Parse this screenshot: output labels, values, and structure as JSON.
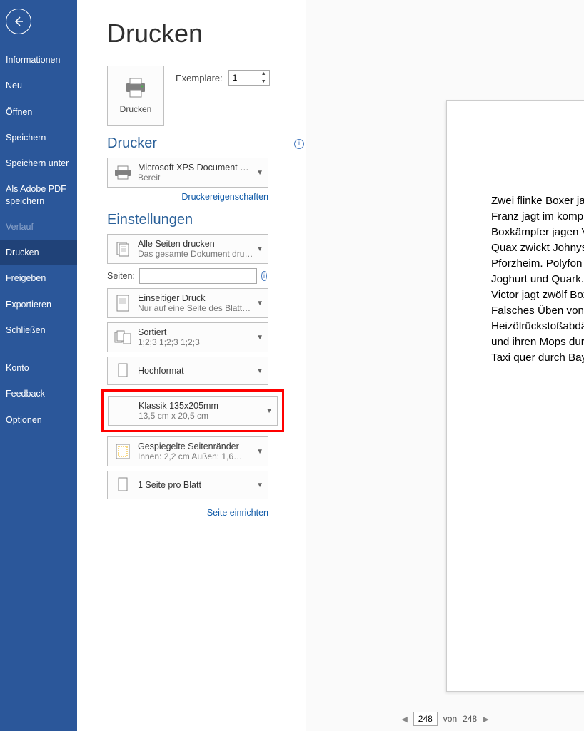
{
  "sidebar": {
    "items": [
      {
        "label": "Informationen"
      },
      {
        "label": "Neu"
      },
      {
        "label": "Öffnen"
      },
      {
        "label": "Speichern"
      },
      {
        "label": "Speichern unter"
      },
      {
        "label": "Als Adobe PDF speichern"
      },
      {
        "label": "Verlauf"
      },
      {
        "label": "Drucken"
      },
      {
        "label": "Freigeben"
      },
      {
        "label": "Exportieren"
      },
      {
        "label": "Schließen"
      },
      {
        "label": "Konto"
      },
      {
        "label": "Feedback"
      },
      {
        "label": "Optionen"
      }
    ]
  },
  "page_title": "Drucken",
  "print_button": {
    "label": "Drucken"
  },
  "copies": {
    "label": "Exemplare:",
    "value": "1"
  },
  "printer_section": {
    "heading": "Drucker",
    "name": "Microsoft XPS Document W…",
    "status": "Bereit",
    "props_link": "Druckereigenschaften"
  },
  "settings_section": {
    "heading": "Einstellungen",
    "print_scope": {
      "line1": "Alle Seiten drucken",
      "line2": "Das gesamte Dokument dru…"
    },
    "pages_label": "Seiten:",
    "pages_value": "",
    "duplex": {
      "line1": "Einseitiger Druck",
      "line2": "Nur auf eine Seite des Blatts…"
    },
    "collate": {
      "line1": "Sortiert",
      "line2": "1;2;3    1;2;3    1;2;3"
    },
    "orientation": {
      "line1": "Hochformat"
    },
    "paper": {
      "line1": "Klassik 135x205mm",
      "line2": "13,5 cm x 20,5 cm"
    },
    "margins": {
      "line1": "Gespiegelte Seitenränder",
      "line2": "Innen:  2,2 cm   Außen:  1,6…"
    },
    "sheets": {
      "line1": "1 Seite pro Blatt"
    },
    "setup_link": "Seite einrichten"
  },
  "preview": {
    "lines": [
      "Zwei flinke Boxer jagen",
      "Franz jagt im komplett v",
      "Boxkämpfer jagen Vikt",
      "Quax  zwickt  Johnys  P",
      "Pforzheim.   Polyfon   zw",
      "Joghurt  und  Quark.  \"F",
      "Victor jagt zwölf Boxk",
      "Falsches  Üben  von  Xy",
      "Heizölrückstoßabdämpf",
      "und ihren Mops durch",
      "Taxi quer durch Bayern"
    ],
    "current_page": "248",
    "total_pages": "248",
    "of_label": "von"
  }
}
